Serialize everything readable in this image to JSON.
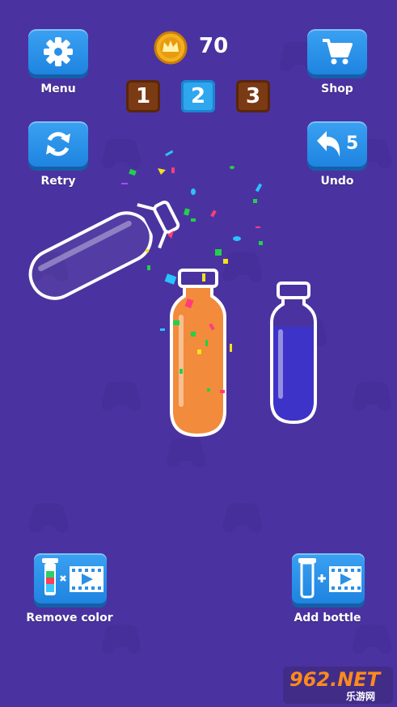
{
  "header": {
    "coins": "70",
    "menu_label": "Menu",
    "shop_label": "Shop",
    "retry_label": "Retry",
    "undo_label": "Undo",
    "undo_count": "5"
  },
  "levels": [
    {
      "label": "1",
      "state": "locked"
    },
    {
      "label": "2",
      "state": "current"
    },
    {
      "label": "3",
      "state": "locked"
    }
  ],
  "bottles": [
    {
      "name": "tilted-empty-bottle",
      "fill": "empty"
    },
    {
      "name": "orange-bottle",
      "fill": "#f28b3b"
    },
    {
      "name": "blue-bottle",
      "fill": "#3e33c8"
    }
  ],
  "footer": {
    "remove_color_label": "Remove color",
    "add_bottle_label": "Add bottle"
  },
  "watermark": {
    "main": "962.NET",
    "sub": "乐游网"
  },
  "colors": {
    "background": "#4a33a0",
    "button": "#1e84e0",
    "level_locked": "#7a3a14",
    "level_current": "#2fa6ee"
  }
}
